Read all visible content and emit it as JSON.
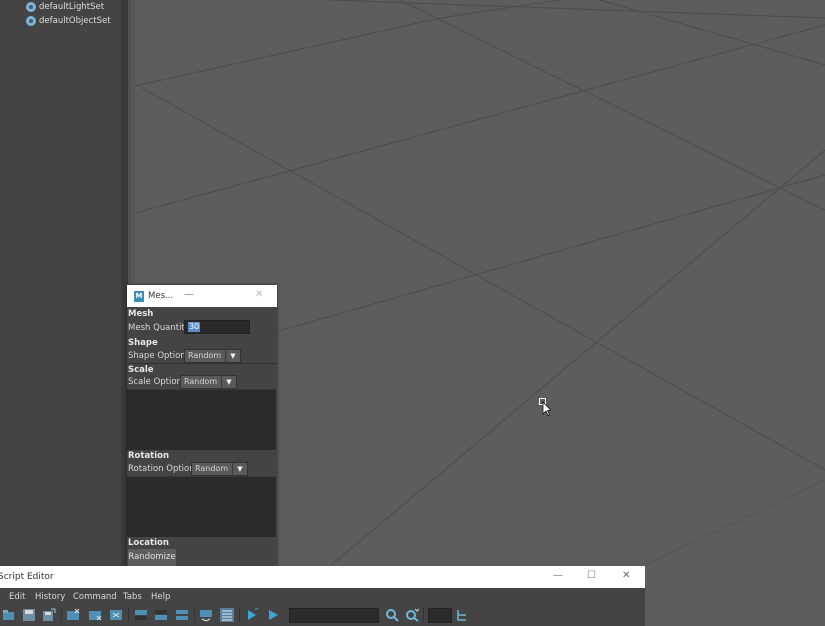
{
  "outliner": {
    "items": [
      {
        "label": "defaultLightSet",
        "icon": "set-icon"
      },
      {
        "label": "defaultObjectSet",
        "icon": "set-icon"
      }
    ]
  },
  "mesh_window": {
    "title": "Mes...",
    "logo_text": "M",
    "minimize_glyph": "—",
    "close_glyph": "✕",
    "mesh_section": "Mesh",
    "mesh_quantity_label": "Mesh Quantity",
    "mesh_quantity_value": "30",
    "shape_section": "Shape",
    "shape_options_label": "Shape Options",
    "shape_options_value": "Random",
    "scale_section": "Scale",
    "scale_options_label": "Scale Options",
    "scale_options_value": "Random",
    "rotation_section": "Rotation",
    "rotation_options_label": "Rotation Options",
    "rotation_options_value": "Random",
    "location_section": "Location",
    "randomize_label": "Randomize",
    "dropdown_arrow": "▼"
  },
  "script_editor": {
    "title": "Script Editor",
    "menus": [
      "Edit",
      "History",
      "Command",
      "Tabs",
      "Help"
    ],
    "minimize_glyph": "—",
    "maximize_glyph": "☐",
    "close_glyph": "✕",
    "toolbar_icons": [
      "open-script-icon",
      "save-script-icon",
      "save-as-icon",
      "clear-history-icon",
      "clear-input-icon",
      "clear-all-icon",
      "show-history-icon",
      "show-input-icon",
      "show-both-icon",
      "echo-commands-icon",
      "line-numbers-icon",
      "execute-all-icon",
      "execute-icon",
      "search-icon",
      "search-options-icon",
      "goto-line-icon"
    ]
  },
  "colors": {
    "viewport_bg": "#5d5d5d",
    "panel_bg": "#444444",
    "grid_line": "#4a4a4a",
    "accent_blue": "#3b8fb9",
    "selection_blue": "#5b8cc9"
  }
}
